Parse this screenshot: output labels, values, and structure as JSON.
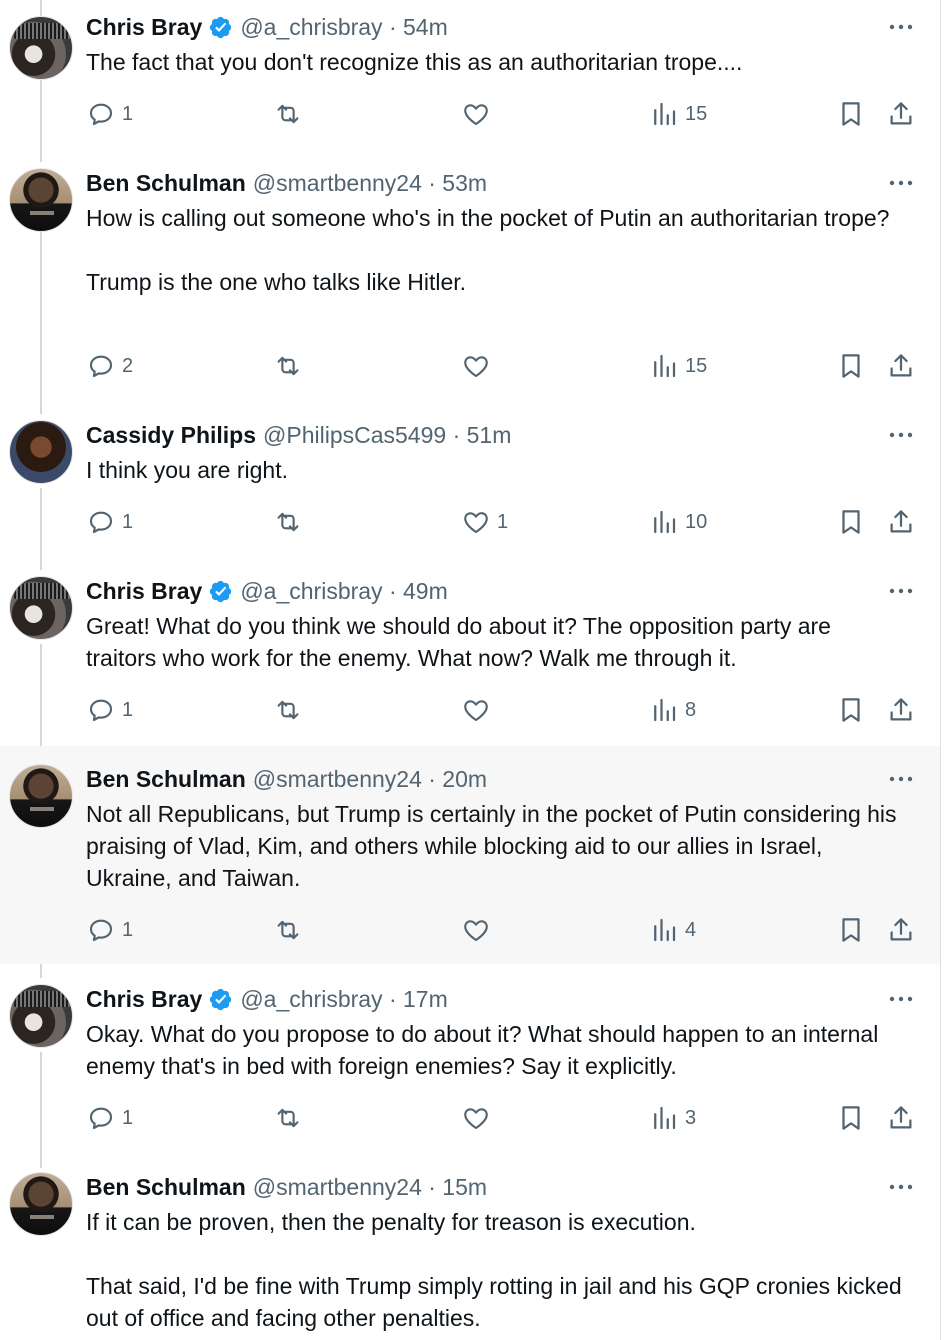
{
  "colors": {
    "text": "#0f1419",
    "secondary": "#536471",
    "verified": "#1d9bf0",
    "thread_line": "#cfd9de",
    "highlight_bg": "#f7f7f8"
  },
  "icons": {
    "verified": "verified-badge-icon",
    "more": "more-options-icon",
    "reply": "reply-icon",
    "retweet": "retweet-icon",
    "like": "like-icon",
    "views": "views-icon",
    "bookmark": "bookmark-icon",
    "share": "share-icon"
  },
  "tweets": [
    {
      "name": "Chris Bray",
      "verified": true,
      "handle": "@a_chrisbray · 54m",
      "text": "The fact that you don't recognize this as an authoritarian trope....",
      "replies": "1",
      "retweets": "",
      "likes": "",
      "views": "15"
    },
    {
      "name": "Ben Schulman",
      "verified": false,
      "handle": "@smartbenny24 · 53m",
      "text": "How is calling out someone who's in the pocket of Putin an authoritarian trope?\n\nTrump is the one who talks like Hitler.",
      "replies": "2",
      "retweets": "",
      "likes": "",
      "views": "15"
    },
    {
      "name": "Cassidy Philips",
      "verified": false,
      "handle": "@PhilipsCas5499 · 51m",
      "text": "I think you are right.",
      "replies": "1",
      "retweets": "",
      "likes": "1",
      "views": "10"
    },
    {
      "name": "Chris Bray",
      "verified": true,
      "handle": "@a_chrisbray · 49m",
      "text": "Great! What do you think we should do about it? The opposition party are traitors who work for the enemy. What now? Walk me through it.",
      "replies": "1",
      "retweets": "",
      "likes": "",
      "views": "8"
    },
    {
      "name": "Ben Schulman",
      "verified": false,
      "handle": "@smartbenny24 · 20m",
      "text": "Not all Republicans, but Trump is certainly in the pocket of Putin considering his praising of Vlad, Kim, and others while blocking aid to our allies in Israel, Ukraine, and Taiwan.",
      "replies": "1",
      "retweets": "",
      "likes": "",
      "views": "4"
    },
    {
      "name": "Chris Bray",
      "verified": true,
      "handle": "@a_chrisbray · 17m",
      "text": "Okay. What do you propose to do about it? What should happen to an internal enemy that's in bed with foreign enemies? Say it explicitly.",
      "replies": "1",
      "retweets": "",
      "likes": "",
      "views": "3"
    },
    {
      "name": "Ben Schulman",
      "verified": false,
      "handle": "@smartbenny24 · 15m",
      "text": "If it can be proven, then the penalty for treason is execution.\n\nThat said, I'd be fine with Trump simply rotting in jail and his GQP cronies kicked out of office and facing other penalties.",
      "replies": "",
      "retweets": "",
      "likes": "",
      "views": ""
    }
  ]
}
